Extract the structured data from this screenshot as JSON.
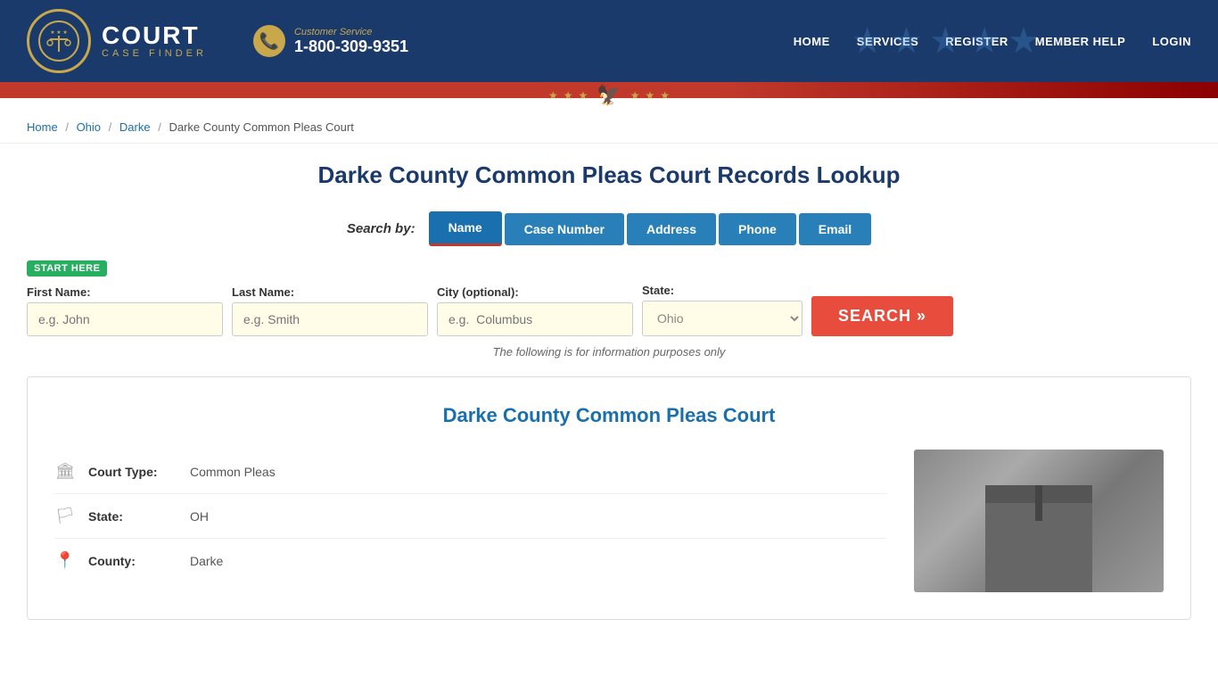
{
  "header": {
    "logo": {
      "court_text": "COURT",
      "case_finder_text": "CASE FINDER"
    },
    "phone": {
      "label": "Customer Service",
      "number": "1-800-309-9351"
    },
    "nav": [
      {
        "label": "HOME",
        "href": "#"
      },
      {
        "label": "SERVICES",
        "href": "#"
      },
      {
        "label": "REGISTER",
        "href": "#"
      },
      {
        "label": "MEMBER HELP",
        "href": "#"
      },
      {
        "label": "LOGIN",
        "href": "#"
      }
    ]
  },
  "breadcrumb": {
    "items": [
      {
        "label": "Home",
        "href": "#"
      },
      {
        "label": "Ohio",
        "href": "#"
      },
      {
        "label": "Darke",
        "href": "#"
      },
      {
        "label": "Darke County Common Pleas Court",
        "href": null
      }
    ]
  },
  "page": {
    "title": "Darke County Common Pleas Court Records Lookup"
  },
  "search": {
    "by_label": "Search by:",
    "tabs": [
      {
        "label": "Name",
        "active": true
      },
      {
        "label": "Case Number",
        "active": false
      },
      {
        "label": "Address",
        "active": false
      },
      {
        "label": "Phone",
        "active": false
      },
      {
        "label": "Email",
        "active": false
      }
    ],
    "start_here_badge": "START HERE",
    "fields": {
      "first_name": {
        "label": "First Name:",
        "placeholder": "e.g. John"
      },
      "last_name": {
        "label": "Last Name:",
        "placeholder": "e.g. Smith"
      },
      "city": {
        "label": "City (optional):",
        "placeholder": "e.g.  Columbus"
      },
      "state": {
        "label": "State:",
        "value": "Ohio"
      }
    },
    "search_button": "SEARCH »",
    "info_note": "The following is for information purposes only"
  },
  "court_card": {
    "title": "Darke County Common Pleas Court",
    "info": [
      {
        "icon": "building-icon",
        "label": "Court Type:",
        "value": "Common Pleas"
      },
      {
        "icon": "flag-icon",
        "label": "State:",
        "value": "OH"
      },
      {
        "icon": "map-icon",
        "label": "County:",
        "value": "Darke"
      }
    ]
  }
}
